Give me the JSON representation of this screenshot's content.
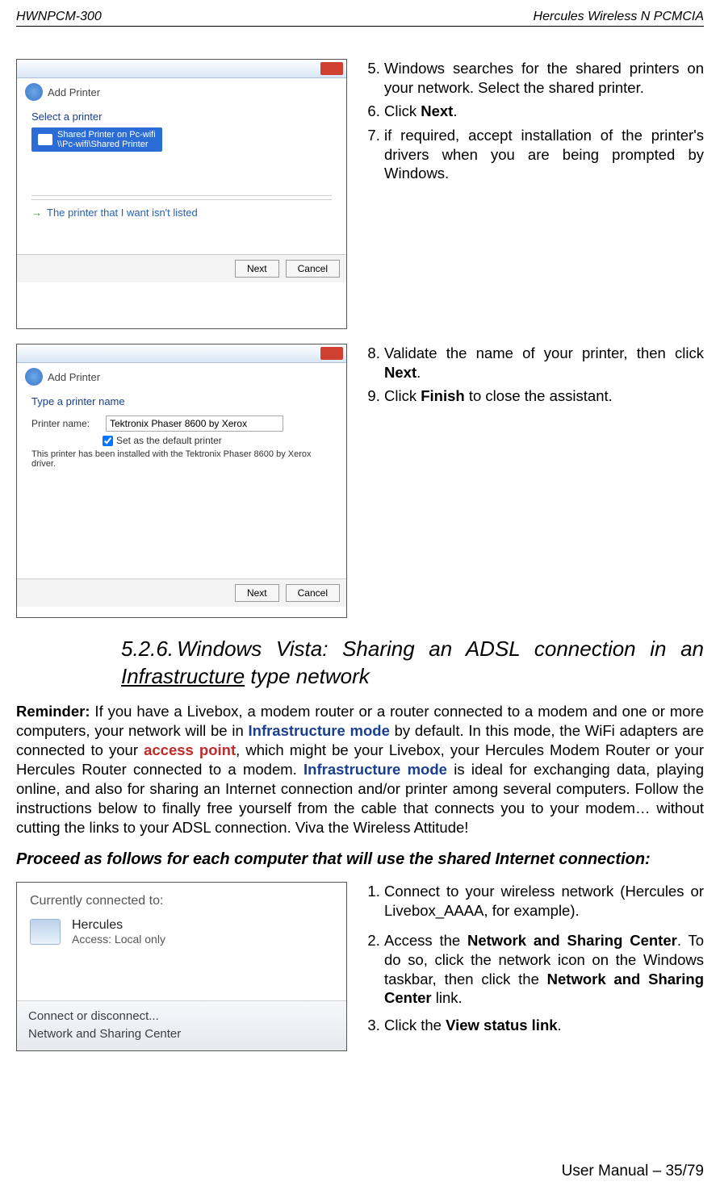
{
  "header": {
    "left": "HWNPCM-300",
    "right": "Hercules Wireless N PCMCIA"
  },
  "dialog1": {
    "title": "Add Printer",
    "heading": "Select a printer",
    "item": "Shared Printer on Pc-wifi\n\\\\Pc-wifi\\Shared Printer",
    "not_listed": "The printer that I want isn't listed",
    "btn_next": "Next",
    "btn_cancel": "Cancel"
  },
  "steps_block1": {
    "s5": "Windows searches for the shared printers on your network. Select the shared printer.",
    "s6_pre": "Click ",
    "s6_b": "Next",
    "s6_post": ".",
    "s7": "if required, accept installation of the printer's drivers when you are being prompted by Windows."
  },
  "dialog2": {
    "title": "Add Printer",
    "heading": "Type a printer name",
    "label": "Printer name:",
    "value": "Tektronix Phaser 8600 by Xerox",
    "chk": "Set as the default printer",
    "note": "This printer has been installed with the Tektronix Phaser 8600 by Xerox driver.",
    "btn_next": "Next",
    "btn_cancel": "Cancel"
  },
  "steps_block2": {
    "s8_pre": "Validate the name of your printer, then click ",
    "s8_b": "Next",
    "s8_post": ".",
    "s9_pre": "Click ",
    "s9_b": "Finish",
    "s9_post": " to close the assistant."
  },
  "section": {
    "number": "5.2.6.",
    "title_pre": "Windows Vista: Sharing an ADSL connection in an ",
    "title_u": "Infrastructure",
    "title_post": " type network"
  },
  "reminder": {
    "lead": "Reminder:",
    "t1": " If you have a Livebox, a modem router or a router connected to a modem and one or more computers, your network will be in ",
    "link1": "Infrastructure mode",
    "t2": " by default.  In this mode, the WiFi adapters are connected to your ",
    "link2": "access point",
    "t3": ", which might be your Livebox, your Hercules Modem Router or your Hercules Router connected to a modem.  ",
    "link3": "Infrastructure mode",
    "t4": " is ideal for exchanging data, playing online, and also for sharing an Internet connection and/or printer among several computers.  Follow the instructions below to finally free yourself from the cable that connects you to your modem… without cutting the links to your ADSL connection.  Viva the Wireless Attitude!"
  },
  "proceed_heading": "Proceed as follows for each computer that will use the shared Internet connection:",
  "net_popup": {
    "heading": "Currently connected to:",
    "name": "Hercules",
    "sub": "Access:  Local only",
    "link1": "Connect or disconnect...",
    "link2": "Network and Sharing Center"
  },
  "steps_block3": {
    "s1": "Connect to your wireless network (Hercules or Livebox_AAAA, for example).",
    "s2_pre": "Access the ",
    "s2_b1": "Network and Sharing Center",
    "s2_mid": ".  To do so, click the network icon on the Windows taskbar, then click the ",
    "s2_b2": "Network and Sharing Center",
    "s2_post": " link.",
    "s3_pre": "Click the ",
    "s3_b": "View status link",
    "s3_post": "."
  },
  "footer": "User Manual – 35/79"
}
